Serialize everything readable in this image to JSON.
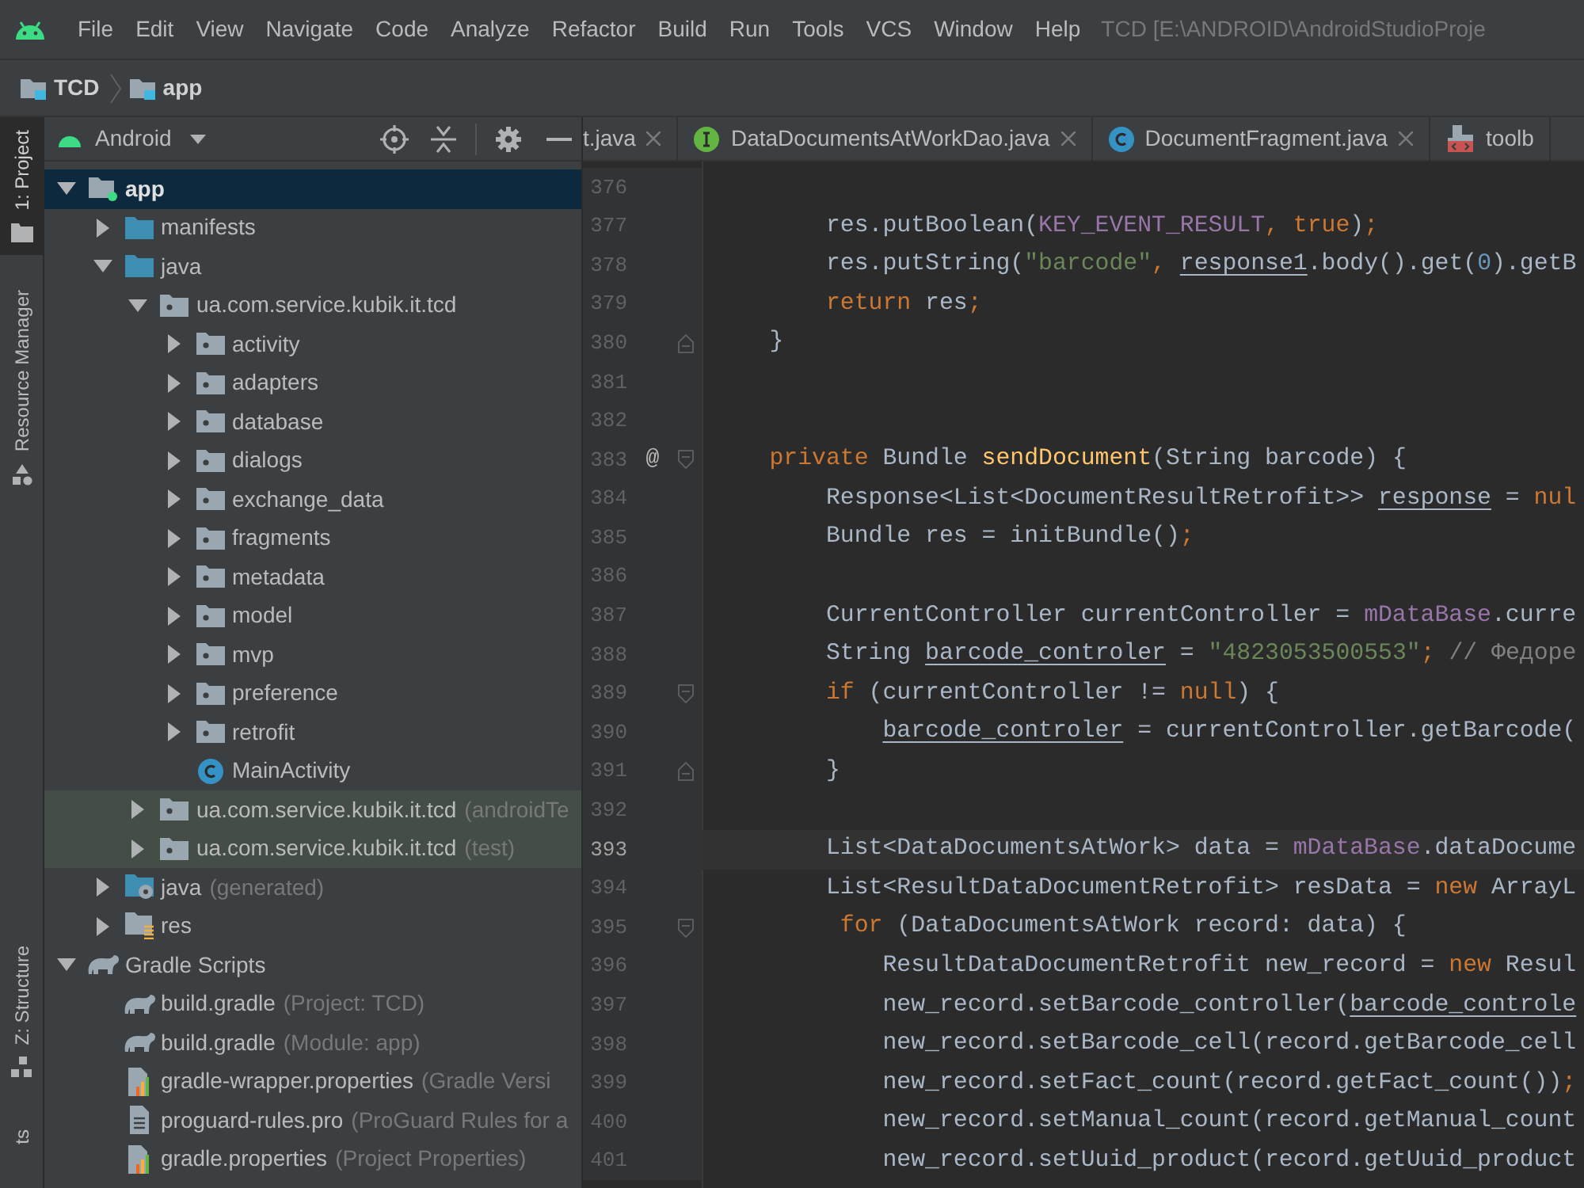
{
  "menu": [
    "File",
    "Edit",
    "View",
    "Navigate",
    "Code",
    "Analyze",
    "Refactor",
    "Build",
    "Run",
    "Tools",
    "VCS",
    "Window",
    "Help"
  ],
  "window": {
    "title": "TCD [E:\\ANDROID\\AndroidStudioProje"
  },
  "breadcrumbs": [
    "TCD",
    "app"
  ],
  "tool_strip": [
    {
      "label": "1: Project",
      "kind": "project",
      "selected": true
    },
    {
      "label": "Resource Manager",
      "kind": "resource",
      "selected": false
    },
    {
      "label": "Z: Structure",
      "kind": "structure",
      "selected": false
    },
    {
      "label": "ts",
      "kind": "plain",
      "selected": false
    }
  ],
  "project_panel": {
    "view": "Android",
    "tree": [
      {
        "label": "app",
        "kind": "module",
        "expanded": true,
        "selected": true,
        "children": [
          {
            "label": "manifests",
            "kind": "folder",
            "expanded": false
          },
          {
            "label": "java",
            "kind": "folder",
            "expanded": true,
            "children": [
              {
                "label": "ua.com.service.kubik.it.tcd",
                "kind": "package",
                "expanded": true,
                "children": [
                  {
                    "label": "activity",
                    "kind": "package",
                    "expanded": false
                  },
                  {
                    "label": "adapters",
                    "kind": "package",
                    "expanded": false
                  },
                  {
                    "label": "database",
                    "kind": "package",
                    "expanded": false
                  },
                  {
                    "label": "dialogs",
                    "kind": "package",
                    "expanded": false
                  },
                  {
                    "label": "exchange_data",
                    "kind": "package",
                    "expanded": false
                  },
                  {
                    "label": "fragments",
                    "kind": "package",
                    "expanded": false
                  },
                  {
                    "label": "metadata",
                    "kind": "package",
                    "expanded": false
                  },
                  {
                    "label": "model",
                    "kind": "package",
                    "expanded": false
                  },
                  {
                    "label": "mvp",
                    "kind": "package",
                    "expanded": false
                  },
                  {
                    "label": "preference",
                    "kind": "package",
                    "expanded": false
                  },
                  {
                    "label": "retrofit",
                    "kind": "package",
                    "expanded": false
                  },
                  {
                    "label": "MainActivity",
                    "kind": "class"
                  }
                ]
              },
              {
                "label": "ua.com.service.kubik.it.tcd",
                "suffix": "(androidTe",
                "kind": "package",
                "expanded": false,
                "test": true
              },
              {
                "label": "ua.com.service.kubik.it.tcd",
                "suffix": "(test)",
                "kind": "package",
                "expanded": false,
                "test": true
              }
            ]
          },
          {
            "label": "java",
            "suffix": "(generated)",
            "kind": "generated",
            "expanded": false
          },
          {
            "label": "res",
            "kind": "res",
            "expanded": false
          }
        ]
      },
      {
        "label": "Gradle Scripts",
        "kind": "gradle",
        "expanded": true,
        "children": [
          {
            "label": "build.gradle",
            "suffix": "(Project: TCD)",
            "kind": "gradle"
          },
          {
            "label": "build.gradle",
            "suffix": "(Module: app)",
            "kind": "gradle"
          },
          {
            "label": "gradle-wrapper.properties",
            "suffix": "(Gradle Versi",
            "kind": "properties"
          },
          {
            "label": "proguard-rules.pro",
            "suffix": "(ProGuard Rules for a",
            "kind": "file"
          },
          {
            "label": "gradle.properties",
            "suffix": "(Project Properties)",
            "kind": "properties"
          }
        ]
      }
    ]
  },
  "editor_tabs": [
    {
      "label": "t.java",
      "kind": "plain",
      "closable": true
    },
    {
      "label": "DataDocumentsAtWorkDao.java",
      "kind": "interface",
      "closable": true
    },
    {
      "label": "DocumentFragment.java",
      "kind": "class",
      "closable": true
    },
    {
      "label": "toolb",
      "kind": "layout",
      "closable": false
    }
  ],
  "code_lines": [
    {
      "number": "376",
      "kind": "plain"
    },
    {
      "number": "377",
      "kind": "plain",
      "segments": [
        {
          "kind": "plain",
          "text": "        res.putBoolean("
        },
        {
          "kind": "field",
          "text": "KEY_EVENT_RESULT"
        },
        {
          "kind": "keyword",
          "text": ", true"
        },
        {
          "kind": "plain",
          "text": ")"
        },
        {
          "kind": "keyword",
          "text": ";"
        }
      ]
    },
    {
      "number": "378",
      "kind": "plain",
      "segments": [
        {
          "kind": "plain",
          "text": "        res.putString("
        },
        {
          "kind": "string",
          "text": "\"barcode\""
        },
        {
          "kind": "keyword",
          "text": ", "
        },
        {
          "kind": "underlined",
          "text": "response1"
        },
        {
          "kind": "plain",
          "text": ".body().get("
        },
        {
          "kind": "number",
          "text": "0"
        },
        {
          "kind": "plain",
          "text": ").getB"
        }
      ]
    },
    {
      "number": "379",
      "kind": "plain",
      "segments": [
        {
          "kind": "keyword",
          "text": "        return"
        },
        {
          "kind": "plain",
          "text": " res"
        },
        {
          "kind": "keyword",
          "text": ";"
        }
      ]
    },
    {
      "number": "380",
      "kind": "fold_end",
      "segments": [
        {
          "kind": "plain",
          "text": "    }"
        }
      ]
    },
    {
      "number": "381",
      "kind": "plain"
    },
    {
      "number": "382",
      "kind": "plain"
    },
    {
      "number": "383",
      "kind": "fold_start",
      "marker": "@",
      "segments": [
        {
          "kind": "keyword",
          "text": "    private"
        },
        {
          "kind": "plain",
          "text": " Bundle "
        },
        {
          "kind": "declaration",
          "text": "sendDocument"
        },
        {
          "kind": "plain",
          "text": "(String barcode) {"
        }
      ]
    },
    {
      "number": "384",
      "kind": "plain",
      "segments": [
        {
          "kind": "plain",
          "text": "        Response<List<DocumentResultRetrofit>> "
        },
        {
          "kind": "underlined",
          "text": "response"
        },
        {
          "kind": "plain",
          "text": " = "
        },
        {
          "kind": "keyword",
          "text": "nul"
        }
      ]
    },
    {
      "number": "385",
      "kind": "plain",
      "segments": [
        {
          "kind": "plain",
          "text": "        Bundle res = initBundle()"
        },
        {
          "kind": "keyword",
          "text": ";"
        }
      ]
    },
    {
      "number": "386",
      "kind": "plain"
    },
    {
      "number": "387",
      "kind": "plain",
      "segments": [
        {
          "kind": "plain",
          "text": "        CurrentController currentController = "
        },
        {
          "kind": "field",
          "text": "mDataBase"
        },
        {
          "kind": "plain",
          "text": ".curre"
        }
      ]
    },
    {
      "number": "388",
      "kind": "plain",
      "segments": [
        {
          "kind": "plain",
          "text": "        String "
        },
        {
          "kind": "underlined",
          "text": "barcode_controler"
        },
        {
          "kind": "plain",
          "text": " = "
        },
        {
          "kind": "string",
          "text": "\"4823053500553\""
        },
        {
          "kind": "keyword",
          "text": ";"
        },
        {
          "kind": "comment",
          "text": " // Федоре"
        }
      ]
    },
    {
      "number": "389",
      "kind": "fold_start",
      "segments": [
        {
          "kind": "keyword",
          "text": "        if"
        },
        {
          "kind": "plain",
          "text": " (currentController != "
        },
        {
          "kind": "keyword",
          "text": "null"
        },
        {
          "kind": "plain",
          "text": ") {"
        }
      ]
    },
    {
      "number": "390",
      "kind": "plain",
      "segments": [
        {
          "kind": "underlined",
          "text": "            barcode_controler"
        },
        {
          "kind": "plain",
          "text": " = currentController.getBarcode("
        }
      ]
    },
    {
      "number": "391",
      "kind": "fold_end",
      "segments": [
        {
          "kind": "plain",
          "text": "        }"
        }
      ]
    },
    {
      "number": "392",
      "kind": "plain"
    },
    {
      "number": "393",
      "kind": "plain",
      "current": true,
      "segments": [
        {
          "kind": "plain",
          "text": "        List<DataDocumentsAtWork> data = "
        },
        {
          "kind": "field",
          "text": "mDataBase"
        },
        {
          "kind": "plain",
          "text": ".dataDocume"
        }
      ]
    },
    {
      "number": "394",
      "kind": "plain",
      "segments": [
        {
          "kind": "plain",
          "text": "        List<ResultDataDocumentRetrofit> resData = "
        },
        {
          "kind": "keyword",
          "text": "new"
        },
        {
          "kind": "plain",
          "text": " ArrayL"
        }
      ]
    },
    {
      "number": "395",
      "kind": "fold_start",
      "segments": [
        {
          "kind": "keyword",
          "text": "         for"
        },
        {
          "kind": "plain",
          "text": " (DataDocumentsAtWork record: data) {"
        }
      ]
    },
    {
      "number": "396",
      "kind": "plain",
      "segments": [
        {
          "kind": "plain",
          "text": "            ResultDataDocumentRetrofit new_record = "
        },
        {
          "kind": "keyword",
          "text": "new"
        },
        {
          "kind": "plain",
          "text": " Resul"
        }
      ]
    },
    {
      "number": "397",
      "kind": "plain",
      "segments": [
        {
          "kind": "plain",
          "text": "            new_record.setBarcode_controller("
        },
        {
          "kind": "underlined",
          "text": "barcode_controle"
        }
      ]
    },
    {
      "number": "398",
      "kind": "plain",
      "segments": [
        {
          "kind": "plain",
          "text": "            new_record.setBarcode_cell(record.getBarcode_cell"
        }
      ]
    },
    {
      "number": "399",
      "kind": "plain",
      "segments": [
        {
          "kind": "plain",
          "text": "            new_record.setFact_count(record.getFact_count())"
        },
        {
          "kind": "keyword",
          "text": ";"
        }
      ]
    },
    {
      "number": "400",
      "kind": "plain",
      "segments": [
        {
          "kind": "plain",
          "text": "            new_record.setManual_count(record.getManual_count"
        }
      ]
    },
    {
      "number": "401",
      "kind": "plain",
      "segments": [
        {
          "kind": "plain",
          "text": "            new_record.setUuid_product(record.getUuid_product"
        }
      ]
    }
  ]
}
